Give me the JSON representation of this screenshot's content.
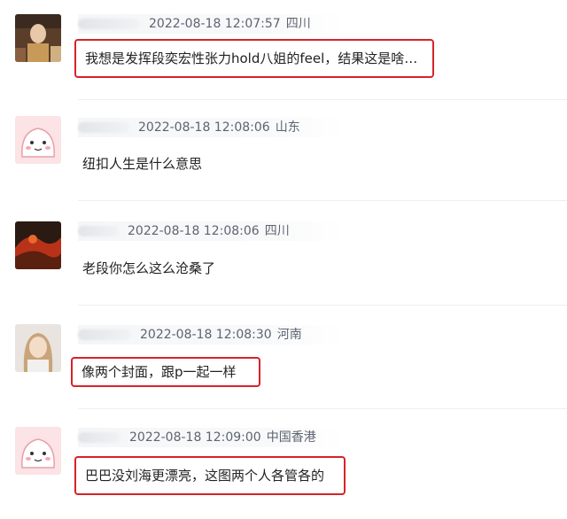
{
  "comments": [
    {
      "time": "2022-08-18 12:07:57",
      "region": "四川",
      "text": "我想是发挥段奕宏性张力hold八姐的feel，结果这是啥…"
    },
    {
      "time": "2022-08-18 12:08:06",
      "region": "山东",
      "text": "纽扣人生是什么意思"
    },
    {
      "time": "2022-08-18 12:08:06",
      "region": "四川",
      "text": "老段你怎么这么沧桑了"
    },
    {
      "time": "2022-08-18 12:08:30",
      "region": "河南",
      "text": "像两个封面，跟p一起一样"
    },
    {
      "time": "2022-08-18 12:09:00",
      "region": "中国香港",
      "text": "巴巴没刘海更漂亮，这图两个人各管各的"
    }
  ]
}
